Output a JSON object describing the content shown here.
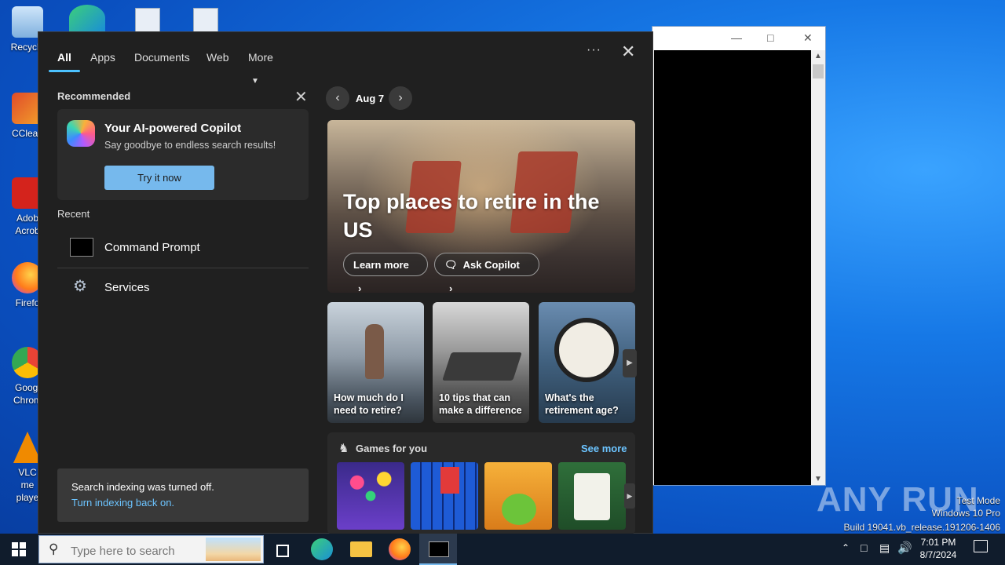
{
  "desktop": {
    "icons": [
      {
        "label": "Recycle",
        "color": "#9fc9f0"
      },
      {
        "label": "CClean",
        "color": "#e04b2a"
      },
      {
        "label": "Adob Acrob",
        "color": "#d4231c"
      },
      {
        "label": "Firefo",
        "color": "#ff7b1a"
      },
      {
        "label": "Googl Chrom",
        "color": "#34a853"
      },
      {
        "label": "VLC me playe",
        "color": "#f08a00"
      }
    ]
  },
  "search_panel": {
    "tabs": {
      "all": "All",
      "apps": "Apps",
      "documents": "Documents",
      "web": "Web",
      "more": "More"
    },
    "recommended": {
      "title": "Recommended",
      "copilot_title": "Your AI-powered Copilot",
      "copilot_sub": "Say goodbye to endless search results!",
      "try_button": "Try it now"
    },
    "recent": {
      "title": "Recent",
      "items": [
        {
          "label": "Command Prompt",
          "icon": "command-prompt-icon"
        },
        {
          "label": "Services",
          "icon": "services-gear-icon"
        }
      ]
    },
    "indexing": {
      "message": "Search indexing was turned off.",
      "link": "Turn indexing back on."
    },
    "highlights": {
      "date": "Aug 7",
      "hero_title": "Top places to retire in the US",
      "learn_more": "Learn more",
      "ask_copilot": "Ask Copilot",
      "cards": [
        "How much do I need to retire?",
        "10 tips that can make a difference",
        "What's the retirement age?"
      ],
      "games_title": "Games for you",
      "see_more": "See more"
    }
  },
  "taskbar": {
    "search_placeholder": "Type here to search",
    "time": "7:01 PM",
    "date": "8/7/2024"
  },
  "watermark": {
    "logo": "ANY RUN",
    "line1": "Test Mode",
    "line2": "Windows 10 Pro",
    "line3": "Build 19041.vb_release.191206-1406"
  }
}
